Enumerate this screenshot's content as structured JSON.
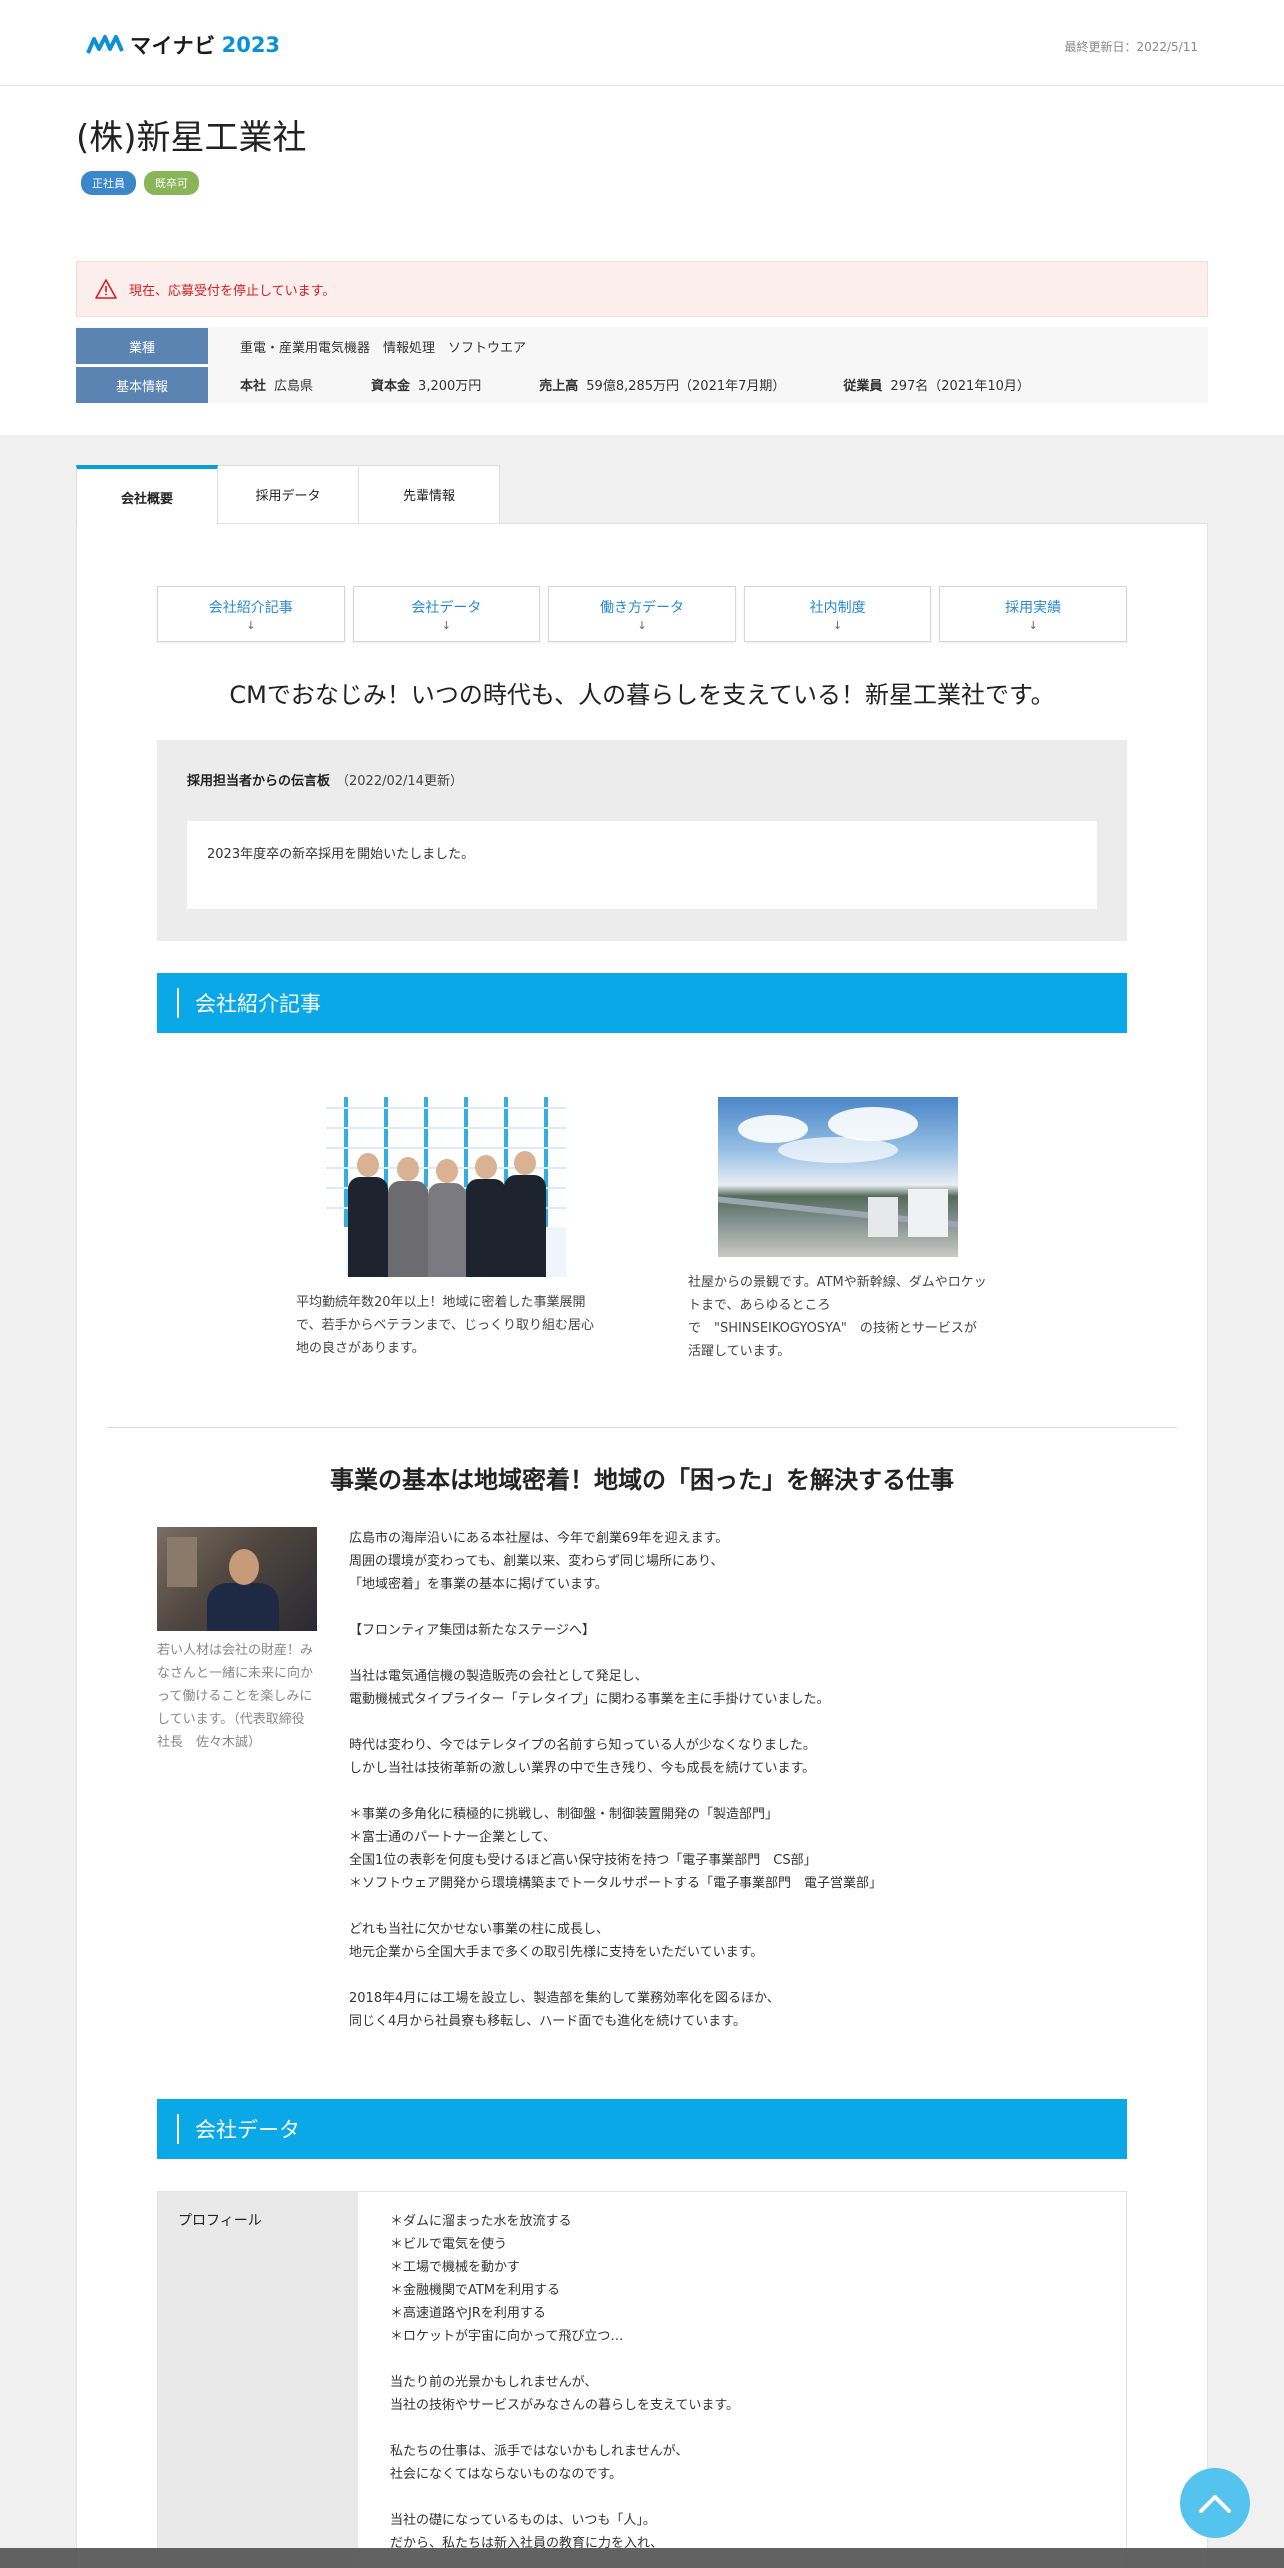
{
  "header": {
    "logo_text": "マイナビ",
    "logo_year": "2023",
    "updated": "最終更新日：2022/5/11"
  },
  "company": {
    "name": "(株)新星工業社",
    "tags": [
      "正社員",
      "既卒可"
    ],
    "alert": "現在、応募受付を停止しています。",
    "industry_label": "業種",
    "industry_value": "重電・産業用電気機器　情報処理　ソフトウエア",
    "basic_label": "基本情報",
    "hq_label": "本社",
    "hq_value": "広島県",
    "capital_label": "資本金",
    "capital_value": "3,200万円",
    "sales_label": "売上高",
    "sales_value": "59億8,285万円（2021年7月期）",
    "employees_label": "従業員",
    "employees_value": "297名（2021年10月）"
  },
  "tabs": [
    "会社概要",
    "採用データ",
    "先輩情報"
  ],
  "anchors": [
    {
      "label": "会社紹介記事",
      "arrow": "↓"
    },
    {
      "label": "会社データ",
      "arrow": "↓"
    },
    {
      "label": "働き方データ",
      "arrow": "↓"
    },
    {
      "label": "社内制度",
      "arrow": "↓"
    },
    {
      "label": "採用実績",
      "arrow": "↓"
    }
  ],
  "catchphrase": "CMでおなじみ！いつの時代も、人の暮らしを支えている！新星工業社です。",
  "message": {
    "title": "採用担当者からの伝言板",
    "date": "（2022/02/14更新）",
    "body": "2023年度卒の新卒採用を開始いたしました。"
  },
  "section_articles": "会社紹介記事",
  "articles": [
    {
      "caption": "平均勤続年数20年以上！地域に密着した事業展開で、若手からベテランまで、じっくり取り組む居心地の良さがあります。"
    },
    {
      "caption": "社屋からの景観です。ATMや新幹線、ダムやロケットまで、あらゆるところで　\"SHINSEIKOGYOSYA\"　の技術とサービスが活躍しています。"
    }
  ],
  "business": {
    "heading": "事業の基本は地域密着！地域の「困った」を解決する仕事",
    "photo_caption": "若い人材は会社の財産！みなさんと一緒に未来に向かって働けることを楽しみにしています。（代表取締役社長　佐々木誠）",
    "text": "広島市の海岸沿いにある本社屋は、今年で創業69年を迎えます。\n周囲の環境が変わっても、創業以来、変わらず同じ場所にあり、\n「地域密着」を事業の基本に掲げています。\n\n【フロンティア集団は新たなステージへ】\n\n当社は電気通信機の製造販売の会社として発足し、\n電動機械式タイプライター「テレタイプ」に関わる事業を主に手掛けていました。\n\n時代は変わり、今ではテレタイプの名前すら知っている人が少なくなりました。\nしかし当社は技術革新の激しい業界の中で生き残り、今も成長を続けています。\n\n＊事業の多角化に積極的に挑戦し、制御盤・制御装置開発の「製造部門」\n＊富士通のパートナー企業として、\n全国1位の表彰を何度も受けるほど高い保守技術を持つ「電子事業部門　CS部」\n＊ソフトウェア開発から環境構築までトータルサポートする「電子事業部門　電子営業部」\n\nどれも当社に欠かせない事業の柱に成長し、\n地元企業から全国大手まで多くの取引先様に支持をいただいています。\n\n2018年4月には工場を設立し、製造部を集約して業務効率化を図るほか、\n同じく4月から社員寮も移転し、ハード面でも進化を続けています。"
  },
  "section_company_data": "会社データ",
  "profile": {
    "label": "プロフィール",
    "text": "＊ダムに溜まった水を放流する\n＊ビルで電気を使う\n＊工場で機械を動かす\n＊金融機関でATMを利用する\n＊高速道路やJRを利用する\n＊ロケットが宇宙に向かって飛び立つ…\n\n当たり前の光景かもしれませんが、\n当社の技術やサービスがみなさんの暮らしを支えています。\n\n私たちの仕事は、派手ではないかもしれませんが、\n社会になくてはならないものなのです。\n\n当社の礎になっているものは、いつも「人」。\nだから、私たちは新入社員の教育に力を入れ、"
  },
  "colors": {
    "accent": "#0aa8e6",
    "alert": "#d42020",
    "info_label": "#5b84b2"
  }
}
